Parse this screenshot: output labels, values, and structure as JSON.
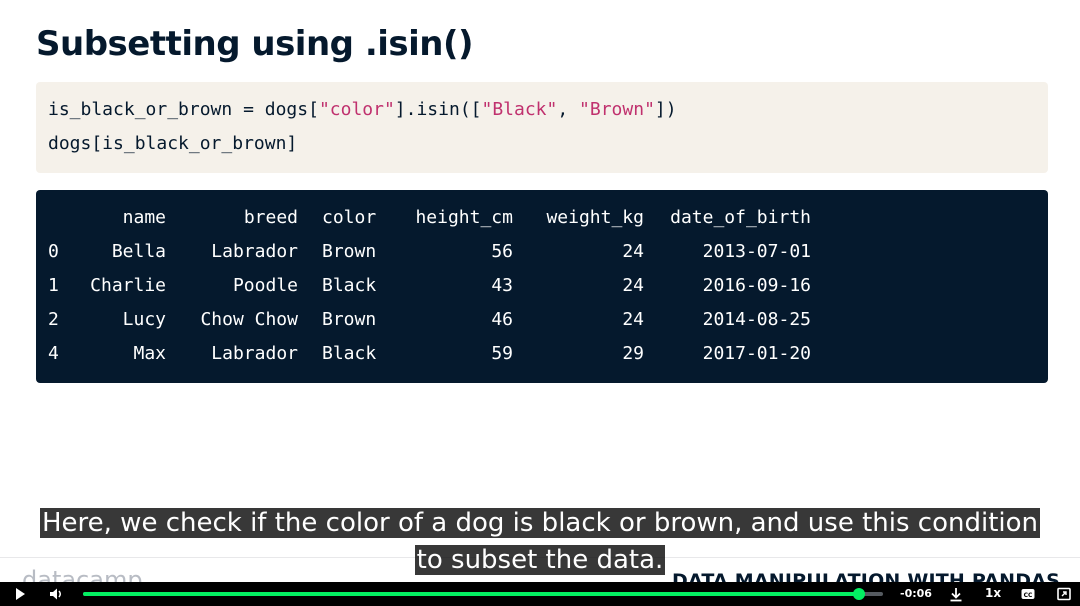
{
  "slide": {
    "title": "Subsetting using .isin()",
    "code_lines": [
      {
        "pre": "is_black_or_brown = dogs[",
        "s1": "\"color\"",
        "mid": "].isin([",
        "s2": "\"Black\"",
        "sep": ", ",
        "s3": "\"Brown\"",
        "post": "])"
      },
      {
        "text": "dogs[is_black_or_brown]"
      }
    ],
    "output": {
      "headers": [
        "",
        "name",
        "breed",
        "color",
        "height_cm",
        "weight_kg",
        "date_of_birth"
      ],
      "rows": [
        [
          "0",
          "Bella",
          "Labrador",
          "Brown",
          "56",
          "24",
          "2013-07-01"
        ],
        [
          "1",
          "Charlie",
          "Poodle",
          "Black",
          "43",
          "24",
          "2016-09-16"
        ],
        [
          "2",
          "Lucy",
          "Chow Chow",
          "Brown",
          "46",
          "24",
          "2014-08-25"
        ],
        [
          "4",
          "Max",
          "Labrador",
          "Black",
          "59",
          "29",
          "2017-01-20"
        ]
      ]
    },
    "footer_logo": "datacamp",
    "footer_course": "DATA MANIPULATION WITH PANDAS"
  },
  "captions": {
    "line1": "Here, we check if the color of a dog is black or brown, and use this condition",
    "line2": "to subset the data."
  },
  "player": {
    "time_remaining": "-0:06",
    "speed": "1x",
    "progress": 0.97,
    "accent": "#03ef62",
    "icons": [
      "play-icon",
      "volume-icon",
      "download-icon",
      "captions-icon",
      "fullscreen-icon"
    ]
  }
}
